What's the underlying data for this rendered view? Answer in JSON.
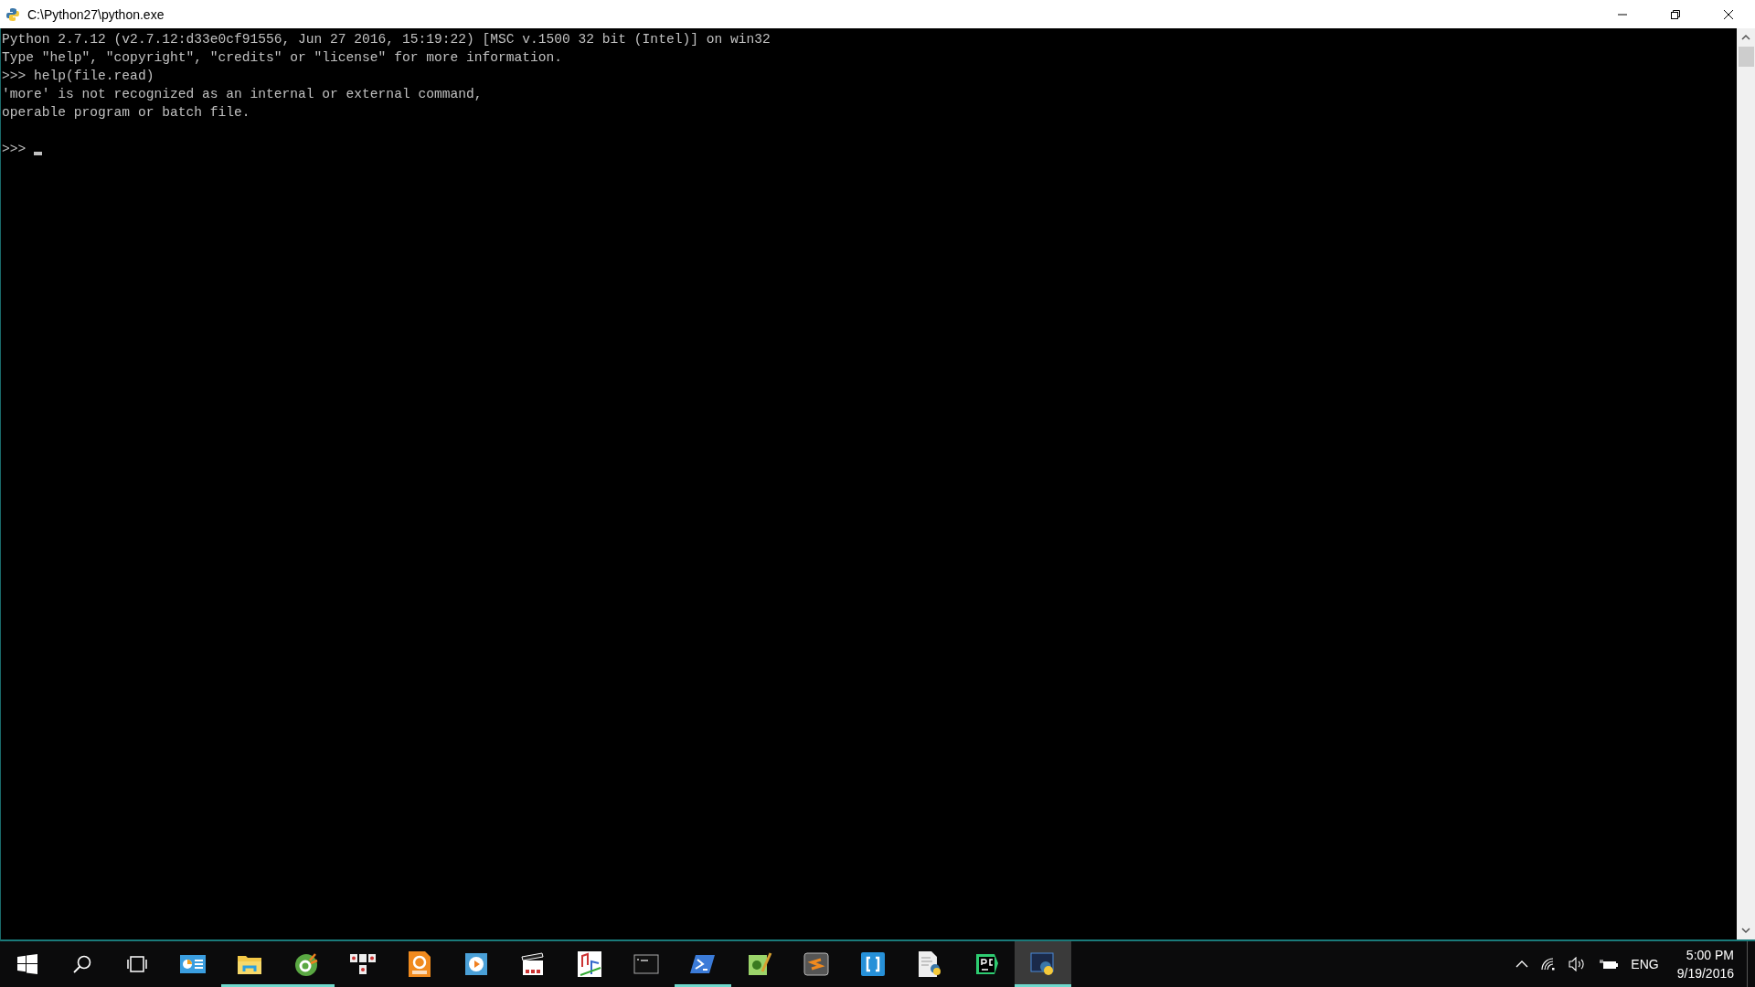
{
  "window": {
    "title": "C:\\Python27\\python.exe"
  },
  "console": {
    "lines": [
      "Python 2.7.12 (v2.7.12:d33e0cf91556, Jun 27 2016, 15:19:22) [MSC v.1500 32 bit (Intel)] on win32",
      "Type \"help\", \"copyright\", \"credits\" or \"license\" for more information.",
      ">>> help(file.read)",
      "'more' is not recognized as an internal or external command,",
      "operable program or batch file."
    ],
    "prompt": ">>>"
  },
  "taskbar": {
    "apps": [
      {
        "kind": "panel",
        "running": false,
        "active": false
      },
      {
        "kind": "folder",
        "running": true,
        "active": false
      },
      {
        "kind": "cleaner",
        "running": true,
        "active": false
      },
      {
        "kind": "keys",
        "running": false,
        "active": false
      },
      {
        "kind": "pdf",
        "running": false,
        "active": false
      },
      {
        "kind": "player",
        "running": false,
        "active": false
      },
      {
        "kind": "clapper",
        "running": false,
        "active": false
      },
      {
        "kind": "music",
        "running": false,
        "active": false
      },
      {
        "kind": "terminal",
        "running": false,
        "active": false
      },
      {
        "kind": "shell",
        "running": true,
        "active": false
      },
      {
        "kind": "notepad",
        "running": false,
        "active": false
      },
      {
        "kind": "sublime",
        "running": false,
        "active": false
      },
      {
        "kind": "brackets",
        "running": false,
        "active": false
      },
      {
        "kind": "pyfile",
        "running": false,
        "active": false
      },
      {
        "kind": "ide",
        "running": false,
        "active": false
      },
      {
        "kind": "pyconsole",
        "running": true,
        "active": true
      }
    ],
    "language": "ENG",
    "time": "5:00 PM",
    "date": "9/19/2016"
  }
}
